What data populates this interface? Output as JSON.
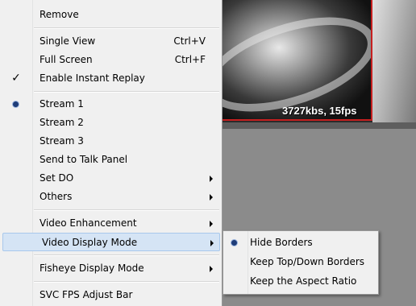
{
  "video": {
    "stats": "3727kbs, 15fps"
  },
  "menu": {
    "items": [
      {
        "label": "Remove"
      },
      {
        "label": "Single View",
        "shortcut": "Ctrl+V"
      },
      {
        "label": "Full Screen",
        "shortcut": "Ctrl+F"
      },
      {
        "label": "Enable Instant Replay",
        "checked": true
      },
      {
        "label": "Stream 1",
        "selected": true
      },
      {
        "label": "Stream 2"
      },
      {
        "label": "Stream 3"
      },
      {
        "label": "Send to Talk Panel"
      },
      {
        "label": "Set DO",
        "submenu": true
      },
      {
        "label": "Others",
        "submenu": true
      },
      {
        "label": "Video Enhancement",
        "submenu": true
      },
      {
        "label": "Video Display Mode",
        "submenu": true,
        "highlighted": true
      },
      {
        "label": "Fisheye Display Mode",
        "submenu": true
      },
      {
        "label": "SVC FPS Adjust Bar"
      }
    ],
    "check_glyph": "✓"
  },
  "submenu": {
    "items": [
      {
        "label": "Hide Borders",
        "selected": true
      },
      {
        "label": "Keep Top/Down Borders"
      },
      {
        "label": "Keep the Aspect Ratio"
      }
    ]
  },
  "colors": {
    "highlight": "#d5e4f5",
    "camera_border": "#c62020",
    "radio_dot": "#1e3c78"
  }
}
